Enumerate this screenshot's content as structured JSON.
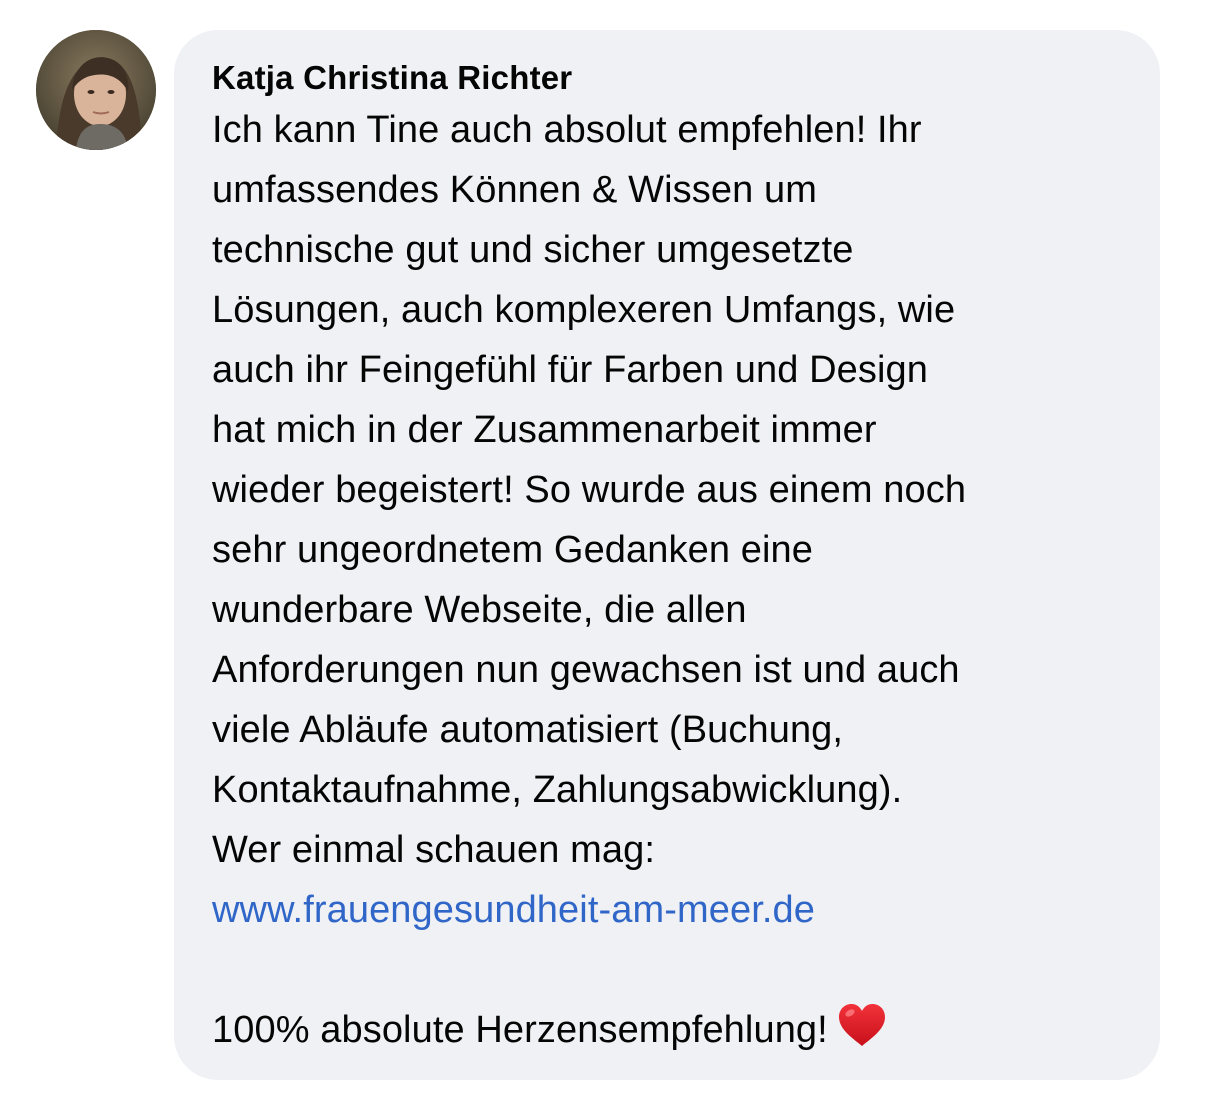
{
  "comment": {
    "author": "Katja Christina Richter",
    "lines": [
      "Ich kann Tine auch absolut empfehlen! Ihr",
      "umfassendes Können & Wissen um",
      "technische gut und sicher umgesetzte",
      "Lösungen, auch komplexeren Umfangs, wie",
      "auch ihr Feingefühl für Farben und Design",
      "hat mich in der Zusammenarbeit immer",
      "wieder begeistert! So wurde aus einem noch",
      "sehr ungeordnetem Gedanken eine",
      "wunderbare Webseite, die allen",
      "Anforderungen nun gewachsen ist und auch",
      "viele Abläufe automatisiert (Buchung,",
      "Kontaktaufnahme, Zahlungsabwicklung).",
      "Wer einmal schauen mag:"
    ],
    "link": "www.frauengesundheit-am-meer.de",
    "closing": "100% absolute Herzensempfehlung!",
    "emoji": "heart-emoji",
    "link_color": "#2f66c8",
    "bubble_color": "#f0f1f5"
  }
}
